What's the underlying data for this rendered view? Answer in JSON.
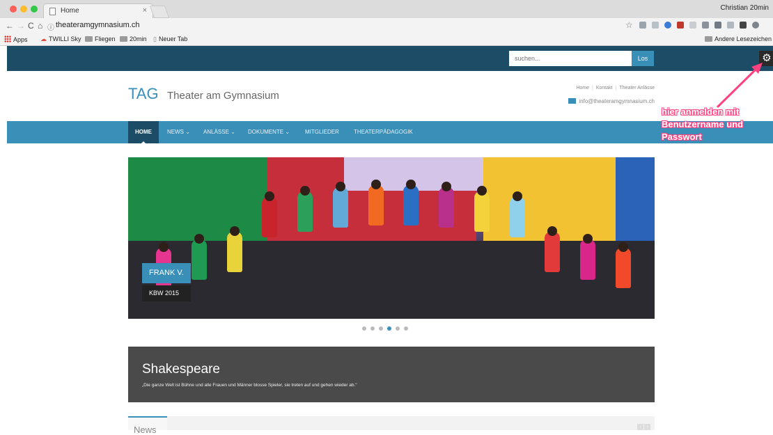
{
  "browser": {
    "tab_title": "Home",
    "tab_close": "×",
    "profile_name": "Christian 20min",
    "url": "theateramgymnasium.ch",
    "bookmarks": [
      "Apps",
      "TWILLI Sky",
      "Fliegen",
      "20min",
      "Neuer Tab"
    ],
    "other_bookmarks": "Andere Lesezeichen"
  },
  "topbar": {
    "search_placeholder": "suchen...",
    "search_button": "Los"
  },
  "header": {
    "logo": "TAG",
    "logo_sub": "Theater am Gymnasium",
    "links": [
      "Home",
      "Kontakt",
      "Theater Anlässe"
    ],
    "email": "info@theateramgymnasium.ch"
  },
  "nav": {
    "items": [
      "HOME",
      "NEWS ⌄",
      "ANLÄSSE ⌄",
      "DOKUMENTE ⌄",
      "MITGLIEDER",
      "THEATERPÄDAGOGIK"
    ]
  },
  "annotation": {
    "line1": "hier anmelden mit",
    "line2": "Benutzername und",
    "line3": "Passwort"
  },
  "slider": {
    "caption_title": "FRANK V.",
    "caption_sub": "KBW 2015",
    "dot_count": 6,
    "active_dot": 4
  },
  "quote": {
    "title": "Shakespeare",
    "text": "„Die ganze Welt ist Bühne und alle Frauen und Männer blosse Spieler, sie treten auf und gehen wieder ab.\""
  },
  "news": {
    "label": "News"
  },
  "colors": {
    "dark_blue": "#1c4c66",
    "accent_blue": "#3a8fb9",
    "annotation_pink": "#ff4081"
  }
}
